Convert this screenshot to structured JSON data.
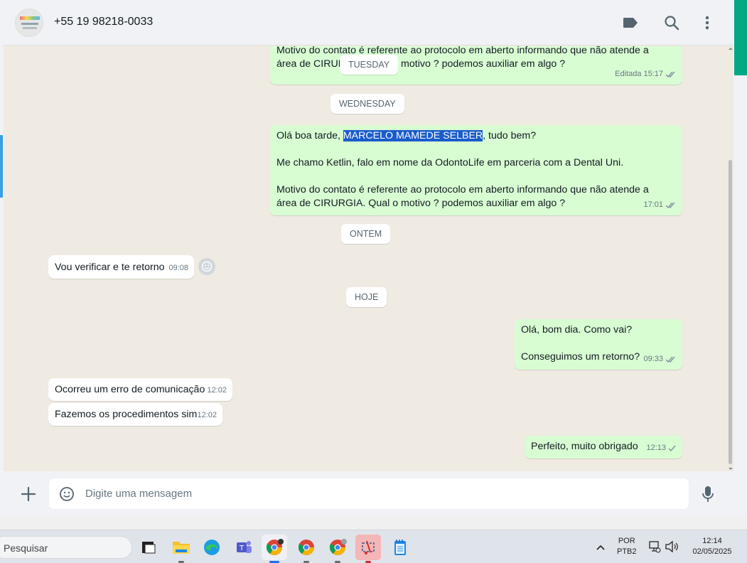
{
  "header": {
    "contact": "+55 19 98218-0033",
    "icons": [
      "label-icon",
      "search-icon",
      "menu-dots-icon"
    ]
  },
  "chat": {
    "messages": [
      {
        "dir": "out",
        "text_line1": "Motivo do contato é referente ao protocolo em aberto informando que não atende a",
        "text_line2": "área de CIRURGIA. Qual o motivo ? podemos auxiliar em algo ?",
        "edited": "Editada",
        "time": "15:17"
      },
      {
        "dir": "out",
        "greeting_pre": "Olá boa tarde, ",
        "greeting_name": "MARCELO MAMEDE SELBER",
        "greeting_post": ", tudo bem?",
        "line2": "Me chamo Ketlin, falo em nome da OdontoLife em parceria com a Dental Uni.",
        "line3": "Motivo do contato é referente ao protocolo em aberto informando que não atende a",
        "line4": "área de CIRURGIA. Qual o motivo ? podemos auxiliar em algo ?",
        "time": "17:01"
      },
      {
        "dir": "in",
        "text": "Vou verificar e te retorno",
        "time": "09:08"
      },
      {
        "dir": "out",
        "line1": "Olá, bom dia. Como vai?",
        "line2": "Conseguimos um retorno?",
        "time": "09:33"
      },
      {
        "dir": "in",
        "text": "Ocorreu um erro de comunicação",
        "time": "12:02"
      },
      {
        "dir": "in",
        "text": "Fazemos os procedimentos sim",
        "time": "12:02"
      },
      {
        "dir": "out",
        "text": "Perfeito, muito obrigado",
        "time": "12:13"
      }
    ],
    "dates": [
      "TUESDAY",
      "WEDNESDAY",
      "ONTEM",
      "HOJE"
    ]
  },
  "footer": {
    "placeholder": "Digite uma mensagem"
  },
  "taskbar": {
    "search_label": "Pesquisar",
    "lang_top": "POR",
    "lang_bottom": "PTB2",
    "time": "12:14",
    "date": "02/05/2025"
  },
  "colors": {
    "chat_bg": "#efeae2",
    "out_bubble": "#d9fdd3",
    "in_bubble": "#ffffff",
    "accent": "#00a884",
    "highlight": "#1a5ccb"
  }
}
